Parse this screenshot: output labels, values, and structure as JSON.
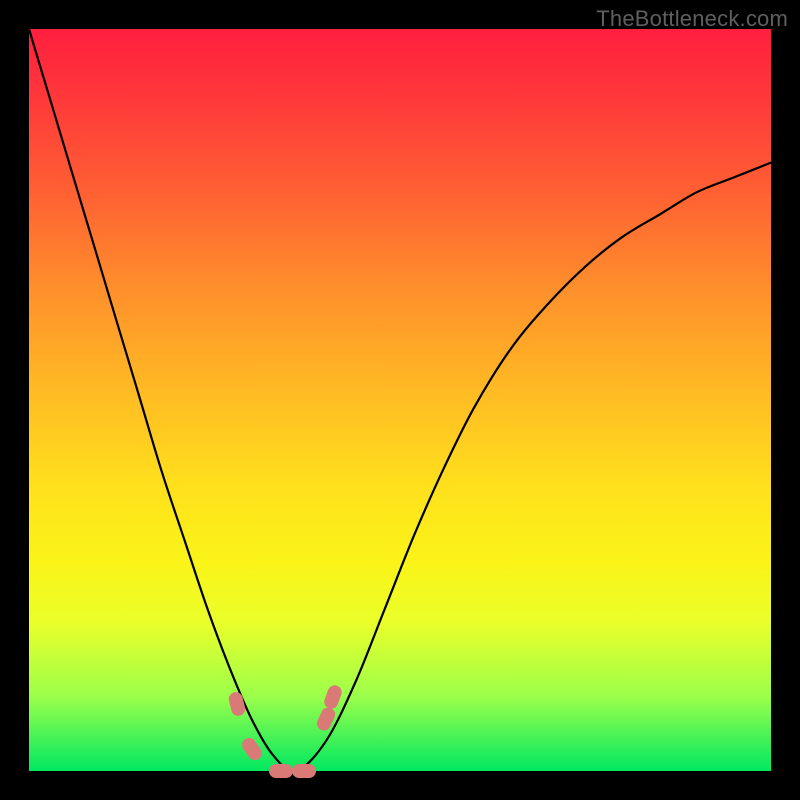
{
  "watermark": "TheBottleneck.com",
  "chart_data": {
    "type": "line",
    "title": "",
    "xlabel": "",
    "ylabel": "",
    "xlim": [
      0,
      100
    ],
    "ylim": [
      0,
      100
    ],
    "x": [
      0,
      3,
      6,
      9,
      12,
      15,
      18,
      21,
      24,
      27,
      30,
      33,
      36,
      40,
      44,
      48,
      52,
      56,
      60,
      65,
      70,
      75,
      80,
      85,
      90,
      95,
      100
    ],
    "values": [
      100,
      90,
      80,
      70,
      60,
      50,
      40,
      31,
      22,
      14,
      7,
      2,
      0,
      4,
      12,
      22,
      32,
      41,
      49,
      57,
      63,
      68,
      72,
      75,
      78,
      80,
      82
    ],
    "series": [
      {
        "name": "bottleneck-curve",
        "values": [
          100,
          90,
          80,
          70,
          60,
          50,
          40,
          31,
          22,
          14,
          7,
          2,
          0,
          4,
          12,
          22,
          32,
          41,
          49,
          57,
          63,
          68,
          72,
          75,
          78,
          80,
          82
        ]
      }
    ],
    "background_gradient_meaning": "red high bottleneck top, green low bottleneck bottom",
    "markers": [
      {
        "x": 28,
        "y": 9,
        "rotation_deg": -14
      },
      {
        "x": 30,
        "y": 3,
        "rotation_deg": -35
      },
      {
        "x": 34,
        "y": 0,
        "rotation_deg": 90
      },
      {
        "x": 37,
        "y": 0,
        "rotation_deg": 90
      },
      {
        "x": 40,
        "y": 7,
        "rotation_deg": 25
      },
      {
        "x": 41,
        "y": 10,
        "rotation_deg": 20
      }
    ]
  }
}
